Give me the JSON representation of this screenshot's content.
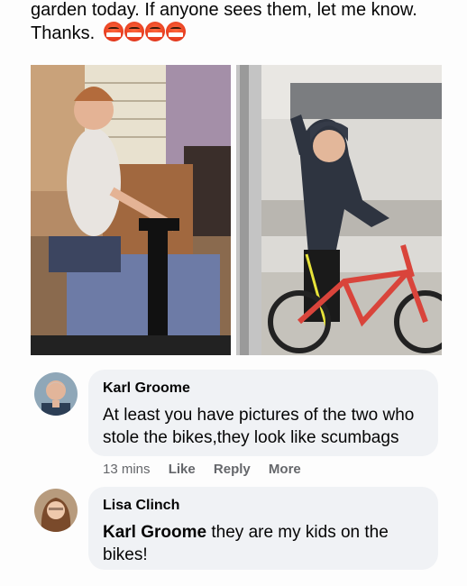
{
  "post": {
    "line1": "garden today. If anyone sees them, let me know.",
    "line2": "Thanks.",
    "emoji": [
      "angry-face-icon",
      "angry-face-icon",
      "angry-face-icon",
      "angry-face-icon"
    ]
  },
  "comments": [
    {
      "author": "Karl Groome",
      "text": "At least you have pictures of the two who stole the bikes,they look like scumbags",
      "time": "13 mins",
      "like": "Like",
      "reply": "Reply",
      "more": "More"
    },
    {
      "author": "Lisa Clinch",
      "mention": "Karl Groome",
      "text": " they are my kids on the bikes!"
    }
  ]
}
